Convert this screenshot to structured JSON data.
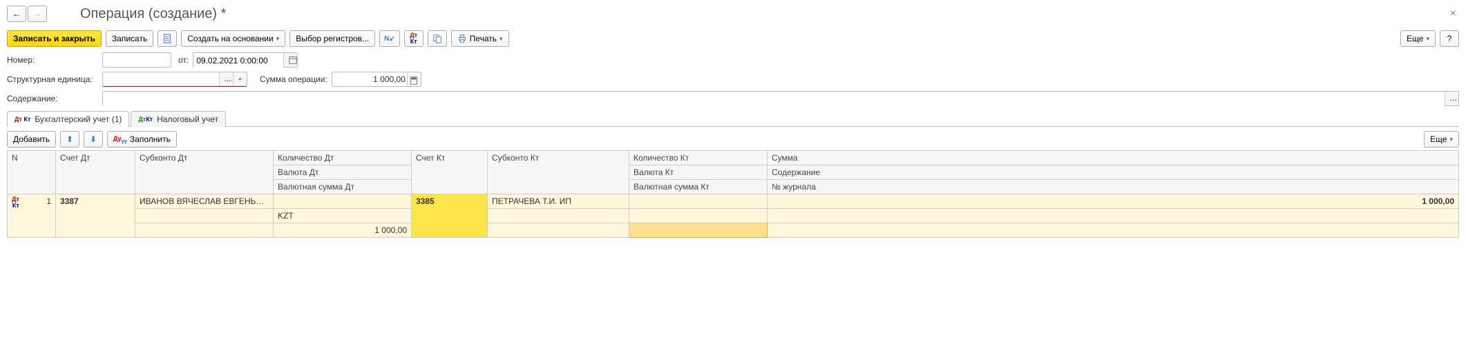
{
  "window": {
    "title": "Операция (создание) *"
  },
  "toolbar": {
    "save_close": "Записать и закрыть",
    "save": "Записать",
    "create_based": "Создать на основании",
    "select_registers": "Выбор регистров...",
    "print": "Печать",
    "more": "Еще"
  },
  "form": {
    "number_label": "Номер:",
    "number_value": "",
    "from_label": "от:",
    "from_value": "09.02.2021 0:00:00",
    "unit_label": "Структурная единица:",
    "unit_value": "",
    "sum_label": "Сумма операции:",
    "sum_value": "1 000,00",
    "content_label": "Содержание:",
    "content_value": ""
  },
  "tabs": {
    "accounting": "Бухгалтерский учет (1)",
    "tax": "Налоговый учет"
  },
  "grid_toolbar": {
    "add": "Добавить",
    "fill": "Заполнить",
    "more": "Еще"
  },
  "grid": {
    "headers": {
      "n": "N",
      "acc_dt": "Счет Дт",
      "sub_dt": "Субконто Дт",
      "qty_dt": "Количество Дт",
      "cur_dt": "Валюта Дт",
      "cursum_dt": "Валютная сумма Дт",
      "acc_kt": "Счет Кт",
      "sub_kt": "Субконто Кт",
      "qty_kt": "Количество Кт",
      "cur_kt": "Валюта Кт",
      "cursum_kt": "Валютная сумма Кт",
      "sum": "Сумма",
      "content": "Содержание",
      "journal": "№ журнала"
    },
    "row": {
      "n": "1",
      "acc_dt": "3387",
      "sub_dt": "ИВАНОВ  ВЯЧЕСЛАВ ЕВГЕНЬЕВИЧ",
      "cur_dt": "KZT",
      "cursum_dt": "1 000,00",
      "acc_kt": "3385",
      "sub_kt": "ПЕТРАЧЕВА Т.И.  ИП",
      "sum": "1 000,00"
    }
  }
}
